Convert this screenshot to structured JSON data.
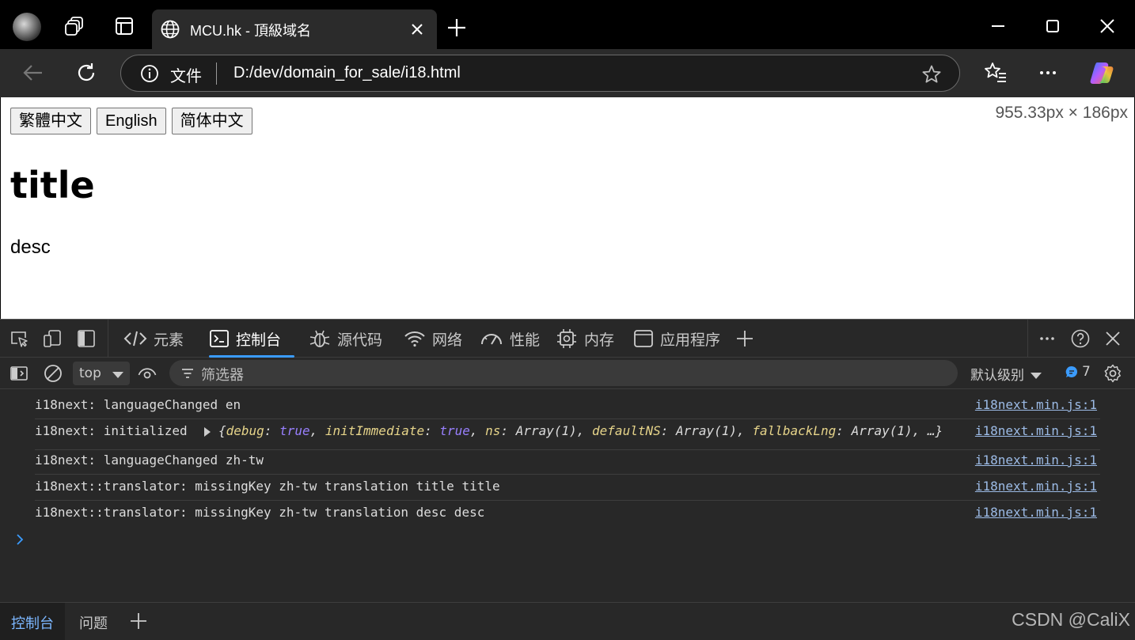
{
  "browser": {
    "tab_title": "MCU.hk - 頂級域名",
    "address": {
      "scheme_label": "文件",
      "url": "D:/dev/domain_for_sale/i18.html"
    }
  },
  "page": {
    "language_buttons": [
      "繁體中文",
      "English",
      "简体中文"
    ],
    "viewport_size_readout": "955.33px × 186px",
    "title": "title",
    "desc": "desc"
  },
  "devtools": {
    "tabs": [
      "元素",
      "控制台",
      "源代码",
      "网络",
      "性能",
      "内存",
      "应用程序"
    ],
    "active_tab": "控制台",
    "filter_bar": {
      "context": "top",
      "filter_placeholder": "筛选器",
      "levels": "默认级别",
      "message_count": "7"
    },
    "console": {
      "messages": [
        {
          "text": "i18next: languageChanged en",
          "source": "i18next.min.js:1"
        },
        {
          "text": "i18next: initialized",
          "source": "i18next.min.js:1",
          "object_preview": "{debug: true, initImmediate: true, ns: Array(1), defaultNS: Array(1), fallbackLng: Array(1), …}"
        },
        {
          "text": "i18next: languageChanged zh-tw",
          "source": "i18next.min.js:1"
        },
        {
          "text": "i18next::translator: missingKey zh-tw translation title title",
          "source": "i18next.min.js:1"
        },
        {
          "text": "i18next::translator: missingKey zh-tw translation desc desc",
          "source": "i18next.min.js:1"
        }
      ]
    },
    "drawer_tabs": [
      "控制台",
      "问题"
    ]
  },
  "watermark": "CSDN @CaliX",
  "colors": {
    "accent": "#3b9cff",
    "link": "#9cbbe6",
    "devtools_bg": "#282828",
    "chrome_bg": "#2b2b2b"
  }
}
